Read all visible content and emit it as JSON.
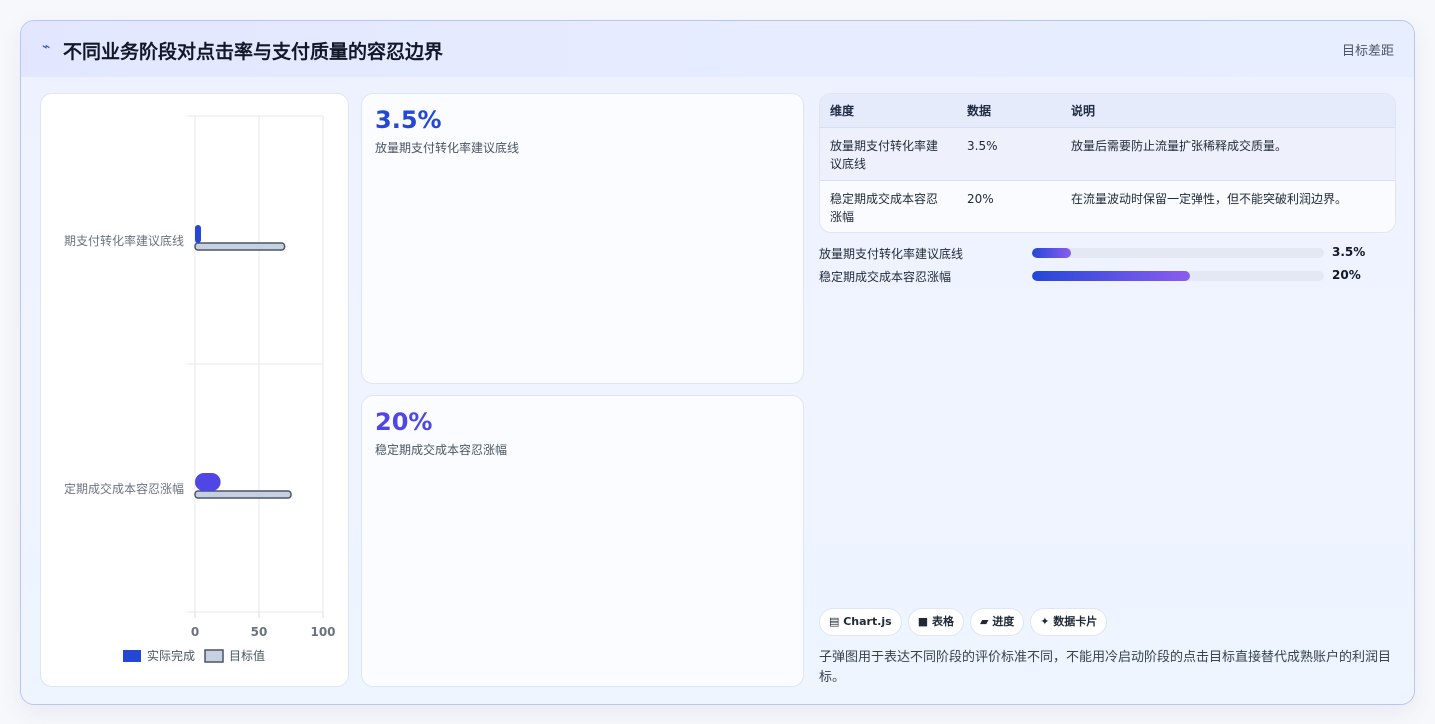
{
  "header": {
    "icon": "chart-line-icon",
    "title": "不同业务阶段对点击率与支付质量的容忍边界",
    "right_label": "目标差距"
  },
  "chart_data": {
    "type": "bar",
    "orientation": "horizontal",
    "categories": [
      "期支付转化率建议底线",
      "定期成交成本容忍涨幅"
    ],
    "series": [
      {
        "name": "实际完成",
        "values": [
          3.5,
          20
        ],
        "color": "#2447d6"
      },
      {
        "name": "目标值",
        "values": [
          70,
          75
        ],
        "color": "#c5d0e3"
      }
    ],
    "xticks": [
      "0",
      "50",
      "100"
    ],
    "xlim": [
      0,
      100
    ],
    "grid": true,
    "legend": "bottom"
  },
  "kpis": [
    {
      "value": "3.5%",
      "label": "放量期支付转化率建议底线",
      "color": "#2447d6"
    },
    {
      "value": "20%",
      "label": "稳定期成交成本容忍涨幅",
      "color": "#4f46e5"
    }
  ],
  "table": {
    "headers": [
      "维度",
      "数据",
      "说明"
    ],
    "rows": [
      [
        "放量期支付转化率建议底线",
        "3.5%",
        "放量后需要防止流量扩张稀释成交质量。"
      ],
      [
        "稳定期成交成本容忍涨幅",
        "20%",
        "在流量波动时保留一定弹性，但不能突破利润边界。"
      ]
    ]
  },
  "progress": [
    {
      "label": "放量期支付转化率建议底线",
      "value": "3.5%",
      "fraction": 0.135
    },
    {
      "label": "稳定期成交成本容忍涨幅",
      "value": "20%",
      "fraction": 0.54
    }
  ],
  "chips": [
    {
      "label": "▤ Chart.js"
    },
    {
      "label": "■ 表格"
    },
    {
      "label": "▰ 进度"
    },
    {
      "label": "✦ 数据卡片"
    }
  ],
  "note": "子弹图用于表达不同阶段的评价标准不同，不能用冷启动阶段的点击目标直接替代成熟账户的利润目标。"
}
